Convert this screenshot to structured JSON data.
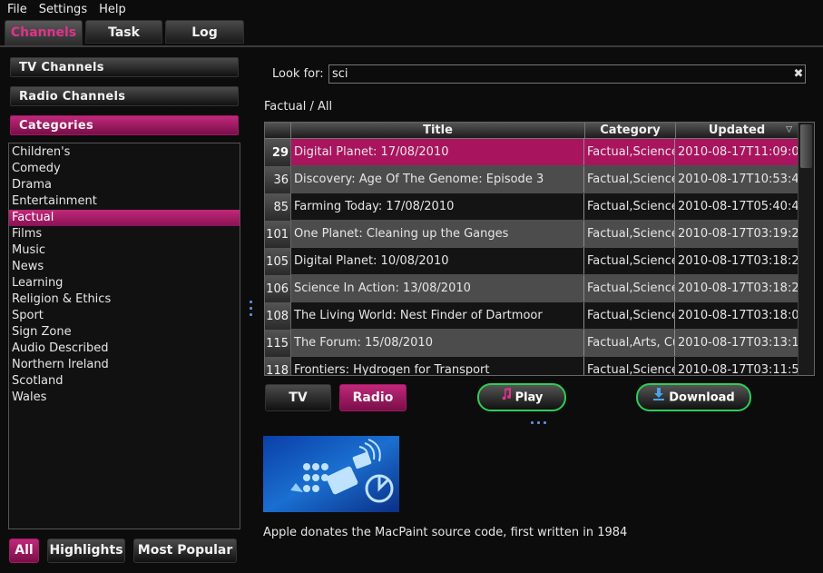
{
  "menu": {
    "file": "File",
    "settings": "Settings",
    "help": "Help"
  },
  "tabs": [
    {
      "label": "Channels"
    },
    {
      "label": "Task"
    },
    {
      "label": "Log"
    }
  ],
  "sidebar": {
    "tv_channels": "TV Channels",
    "radio_channels": "Radio Channels",
    "categories": "Categories",
    "category_items": [
      "Children's",
      "Comedy",
      "Drama",
      "Entertainment",
      "Factual",
      "Films",
      "Music",
      "News",
      "Learning",
      "Religion & Ethics",
      "Sport",
      "Sign Zone",
      "Audio Described",
      "Northern Ireland",
      "Scotland",
      "Wales"
    ],
    "selected_category": "Factual",
    "filters": {
      "all": "All",
      "highlights": "Highlights",
      "most_popular": "Most Popular"
    }
  },
  "search": {
    "label": "Look for:",
    "value": "sci"
  },
  "breadcrumb": "Factual / All",
  "table": {
    "columns": [
      "Title",
      "Category",
      "Updated"
    ],
    "rows": [
      {
        "num": "29",
        "title": "Digital Planet: 17/08/2010",
        "category": "Factual,Science",
        "updated": "2010-08-17T11:09:0"
      },
      {
        "num": "36",
        "title": "Discovery: Age Of The Genome: Episode 3",
        "category": "Factual,Science",
        "updated": "2010-08-17T10:53:4"
      },
      {
        "num": "85",
        "title": "Farming Today: 17/08/2010",
        "category": "Factual,Science",
        "updated": "2010-08-17T05:40:4"
      },
      {
        "num": "101",
        "title": "One Planet: Cleaning up the Ganges",
        "category": "Factual,Science",
        "updated": "2010-08-17T03:19:2"
      },
      {
        "num": "105",
        "title": "Digital Planet: 10/08/2010",
        "category": "Factual,Science",
        "updated": "2010-08-17T03:18:2"
      },
      {
        "num": "106",
        "title": "Science In Action: 13/08/2010",
        "category": "Factual,Science",
        "updated": "2010-08-17T03:18:2"
      },
      {
        "num": "108",
        "title": "The Living World: Nest Finder of Dartmoor",
        "category": "Factual,Science",
        "updated": "2010-08-17T03:18:0"
      },
      {
        "num": "115",
        "title": "The Forum: 15/08/2010",
        "category": "Factual,Arts, Cu",
        "updated": "2010-08-17T03:13:1"
      },
      {
        "num": "118",
        "title": "Frontiers: Hydrogen for Transport",
        "category": "Factual,Science",
        "updated": "2010-08-17T03:11:5"
      }
    ],
    "selected_row": 0
  },
  "mode": {
    "tv": "TV",
    "radio": "Radio"
  },
  "actions": {
    "play": "Play",
    "download": "Download"
  },
  "details": {
    "description": "Apple donates the MacPaint source code, first written in 1984"
  },
  "colors": {
    "accent": "#a9145f",
    "action_border": "#2ccf55",
    "splitter": "#5b8fe0"
  }
}
